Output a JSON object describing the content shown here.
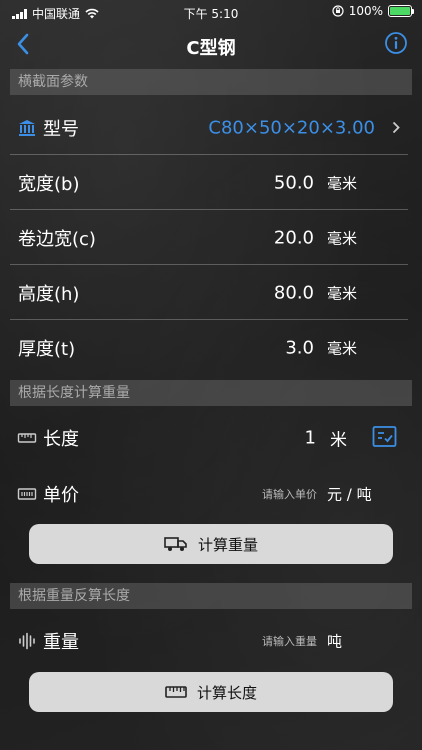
{
  "status_bar": {
    "carrier": "中国联通",
    "time": "下午 5:10",
    "battery_percent": "100%",
    "battery_level": 1.0
  },
  "nav": {
    "title": "C型钢"
  },
  "sections": {
    "cross_section": "横截面参数",
    "weight_by_length": "根据长度计算重量",
    "length_by_weight": "根据重量反算长度"
  },
  "cross_section": {
    "model_label": "型号",
    "model_value": "C80×50×20×3.00",
    "params": [
      {
        "label": "宽度(b)",
        "value": "50.0",
        "unit": "毫米"
      },
      {
        "label": "卷边宽(c)",
        "value": "20.0",
        "unit": "毫米"
      },
      {
        "label": "高度(h)",
        "value": "80.0",
        "unit": "毫米"
      },
      {
        "label": "厚度(t)",
        "value": "3.0",
        "unit": "毫米"
      }
    ]
  },
  "weight_calc": {
    "length_label": "长度",
    "length_value": "1",
    "length_unit": "米",
    "price_label": "单价",
    "price_placeholder": "请输入单价",
    "price_unit": "元 / 吨",
    "button_label": "计算重量"
  },
  "length_calc": {
    "weight_label": "重量",
    "weight_placeholder": "请输入重量",
    "weight_unit": "吨",
    "button_label": "计算长度"
  },
  "colors": {
    "accent": "#3b8fe6",
    "section_bg": "#555555",
    "button_bg": "#d9d9d9"
  }
}
